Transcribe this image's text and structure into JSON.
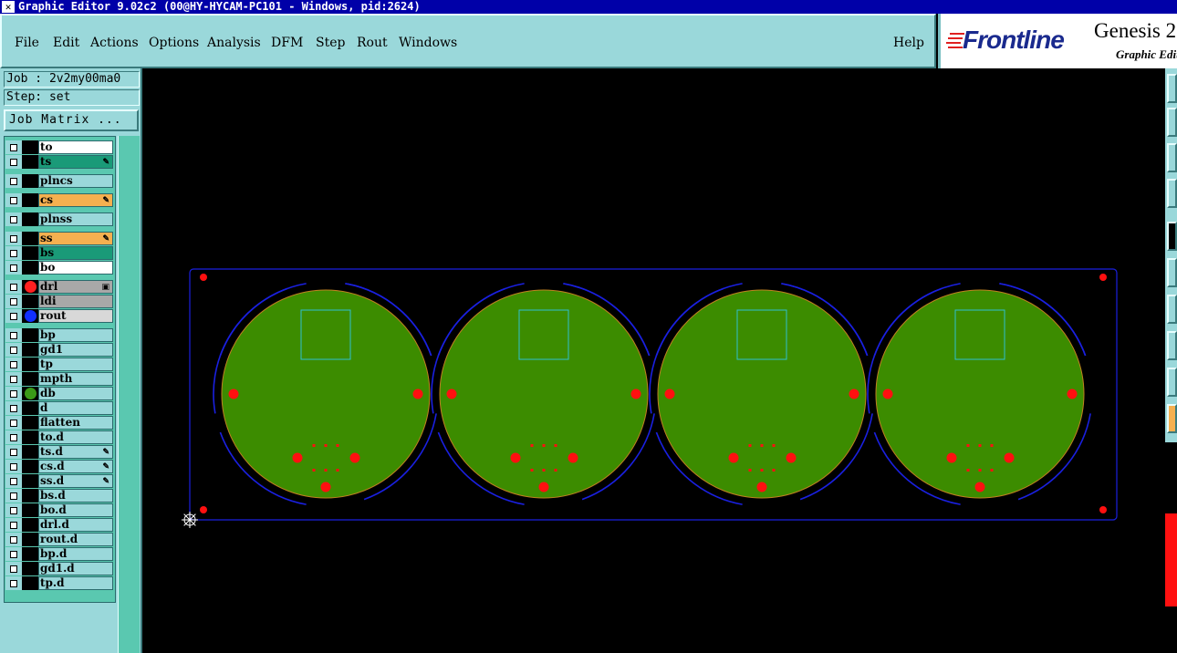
{
  "window": {
    "title": "Graphic Editor 9.02c2 (00@HY-HYCAM-PC101 - Windows, pid:2624)"
  },
  "menu": {
    "items": [
      {
        "label": "File"
      },
      {
        "label": "Edit"
      },
      {
        "label": "Actions"
      },
      {
        "label": "Options"
      },
      {
        "label": "Analysis"
      },
      {
        "label": "DFM"
      },
      {
        "label": "Step"
      },
      {
        "label": "Rout"
      },
      {
        "label": "Windows"
      }
    ],
    "help": "Help"
  },
  "logo": {
    "brand": "Frontline",
    "product": "Genesis 2",
    "subtitle": "Graphic Edit"
  },
  "job_info": {
    "job": "Job : 2v2my00ma0",
    "step": "Step: set",
    "matrix_button": "Job Matrix ..."
  },
  "layers": [
    {
      "name": "to",
      "bg": "#ffffff",
      "dot": "",
      "mark": ""
    },
    {
      "name": "ts",
      "bg": "#1a9a78",
      "dot": "",
      "mark": "✎"
    },
    {
      "name": "plncs",
      "bg": "#9ad8da",
      "dot": "",
      "mark": ""
    },
    {
      "name": "cs",
      "bg": "#f5b050",
      "dot": "",
      "mark": "✎"
    },
    {
      "name": "plnss",
      "bg": "#9ad8da",
      "dot": "",
      "mark": ""
    },
    {
      "name": "ss",
      "bg": "#f5b050",
      "dot": "",
      "mark": "✎"
    },
    {
      "name": "bs",
      "bg": "#1a9a78",
      "dot": "",
      "mark": ""
    },
    {
      "name": "bo",
      "bg": "#ffffff",
      "dot": "",
      "mark": ""
    },
    {
      "name": "drl",
      "bg": "#a8a8a8",
      "dot": "#ff2020",
      "mark": "▣"
    },
    {
      "name": "ldi",
      "bg": "#a8a8a8",
      "dot": "",
      "mark": ""
    },
    {
      "name": "rout",
      "bg": "#d8d8d8",
      "dot": "#1030ff",
      "mark": ""
    },
    {
      "name": "bp",
      "bg": "#9ad8da",
      "dot": "",
      "mark": ""
    },
    {
      "name": "gd1",
      "bg": "#9ad8da",
      "dot": "",
      "mark": ""
    },
    {
      "name": "tp",
      "bg": "#9ad8da",
      "dot": "",
      "mark": ""
    },
    {
      "name": "mpth",
      "bg": "#9ad8da",
      "dot": "",
      "mark": ""
    },
    {
      "name": "db",
      "bg": "#9ad8da",
      "dot": "#3a9a18",
      "mark": ""
    },
    {
      "name": "d",
      "bg": "#9ad8da",
      "dot": "",
      "mark": ""
    },
    {
      "name": "flatten",
      "bg": "#9ad8da",
      "dot": "",
      "mark": ""
    },
    {
      "name": "to.d",
      "bg": "#9ad8da",
      "dot": "",
      "mark": ""
    },
    {
      "name": "ts.d",
      "bg": "#9ad8da",
      "dot": "",
      "mark": "✎"
    },
    {
      "name": "cs.d",
      "bg": "#9ad8da",
      "dot": "",
      "mark": "✎"
    },
    {
      "name": "ss.d",
      "bg": "#9ad8da",
      "dot": "",
      "mark": "✎"
    },
    {
      "name": "bs.d",
      "bg": "#9ad8da",
      "dot": "",
      "mark": ""
    },
    {
      "name": "bo.d",
      "bg": "#9ad8da",
      "dot": "",
      "mark": ""
    },
    {
      "name": "drl.d",
      "bg": "#9ad8da",
      "dot": "",
      "mark": ""
    },
    {
      "name": "rout.d",
      "bg": "#9ad8da",
      "dot": "",
      "mark": ""
    },
    {
      "name": "bp.d",
      "bg": "#9ad8da",
      "dot": "",
      "mark": ""
    },
    {
      "name": "gd1.d",
      "bg": "#9ad8da",
      "dot": "",
      "mark": ""
    },
    {
      "name": "tp.d",
      "bg": "#9ad8da",
      "dot": "",
      "mark": ""
    }
  ],
  "colors": {
    "board_fill": "#3c8c00",
    "pad": "#ff1010",
    "outline": "#1a20e0",
    "silk_box": "#30c0d0"
  }
}
